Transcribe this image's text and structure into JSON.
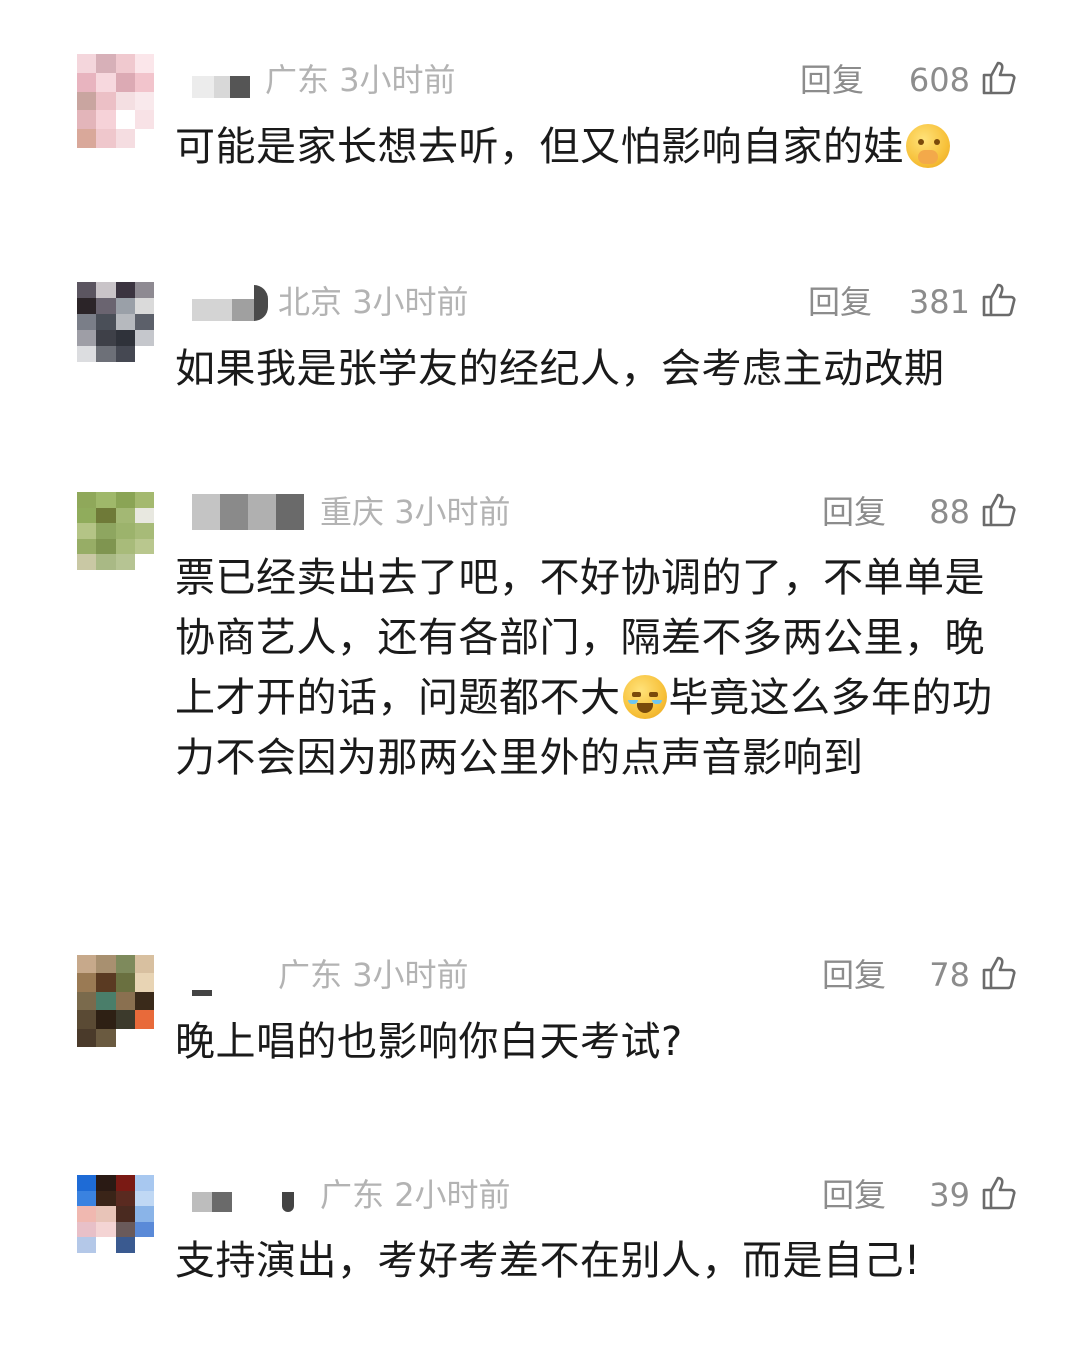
{
  "comments": [
    {
      "location": "广东",
      "time": "3小时前",
      "reply_label": "回复",
      "likes": "608",
      "text": "可能是家长想去听，但又怕影响自家的娃",
      "emoji": "hand-over-mouth-emoji",
      "avatar_colors": [
        "#f4d6dc",
        "#d7b0b8",
        "#f0c9cf",
        "#fbe6ea",
        "#e8b4bf",
        "#f7d8de",
        "#dcaab4",
        "#f2c4cc",
        "#c9a5a0",
        "#ecc0c6",
        "#f4dfe2",
        "#f9e9ec",
        "#e3b5ba",
        "#f6d2d8",
        "#ffffff",
        "#f8e2e6",
        "#d9a89a",
        "#efc7cc",
        "#f5dde1",
        "#ffffff"
      ]
    },
    {
      "location": "北京",
      "time": "3小时前",
      "reply_label": "回复",
      "likes": "381",
      "text": "如果我是张学友的经纪人，会考虑主动改期",
      "avatar_colors": [
        "#5b5560",
        "#c9c4c8",
        "#3b3440",
        "#8e8a92",
        "#2b2428",
        "#6a6470",
        "#9aa0a8",
        "#dadada",
        "#7a7e88",
        "#4a4f58",
        "#b6b9be",
        "#5c606a",
        "#9e9ea6",
        "#3e4048",
        "#2f323a",
        "#c5c7cc",
        "#dcdde0",
        "#6d7078",
        "#454852",
        "#ffffff"
      ]
    },
    {
      "location": "重庆",
      "time": "3小时前",
      "reply_label": "回复",
      "likes": "88",
      "text": "票已经卖出去了吧，不好协调的了，不单单是协商艺人，还有各部门，隔差不多两公里，晚上才开的话，问题都不大",
      "text_after": "毕竟这么多年的功力不会因为那两公里外的点声音影响到",
      "emoji": "crying-laughing-emoji",
      "avatar_colors": [
        "#8fa85a",
        "#9fb86a",
        "#8aa455",
        "#a4b96f",
        "#90ac5c",
        "#6f7a38",
        "#a3b874",
        "#e8e8e0",
        "#b4c486",
        "#8ea660",
        "#9cb36c",
        "#a7bb78",
        "#97ad66",
        "#7f9550",
        "#a8bb7a",
        "#b9c78e",
        "#c9c8a4",
        "#a9b985",
        "#b6c493",
        "#ffffff"
      ]
    },
    {
      "location": "广东",
      "time": "3小时前",
      "reply_label": "回复",
      "likes": "78",
      "text": "晚上唱的也影响你白天考试?",
      "avatar_colors": [
        "#c7a98b",
        "#a89070",
        "#7e8a5c",
        "#d8c0a0",
        "#9a7a54",
        "#5a3a22",
        "#6a7040",
        "#e8d4b4",
        "#7a6a4c",
        "#4a7e6a",
        "#8a7050",
        "#3a2a1a",
        "#5a4a34",
        "#2e2014",
        "#3c3a2c",
        "#e86a3a",
        "#4a3a2a",
        "#6a5a40",
        "#ffffff",
        "#ffffff"
      ]
    },
    {
      "location": "广东",
      "time": "2小时前",
      "reply_label": "回复",
      "likes": "39",
      "text": "支持演出，考好考差不在别人，而是自己!",
      "avatar_colors": [
        "#1e6bd6",
        "#2a1a14",
        "#7a1a14",
        "#a8c8f0",
        "#3a82e0",
        "#3a2418",
        "#5a2a20",
        "#c0d8f4",
        "#f0b8b0",
        "#e8c4b8",
        "#4a2a20",
        "#8ab4e8",
        "#e8c0c8",
        "#f4d4d4",
        "#6a5a5a",
        "#5a8ad8",
        "#b4c8e8",
        "#ffffff",
        "#3a5a90",
        "#ffffff"
      ]
    }
  ]
}
